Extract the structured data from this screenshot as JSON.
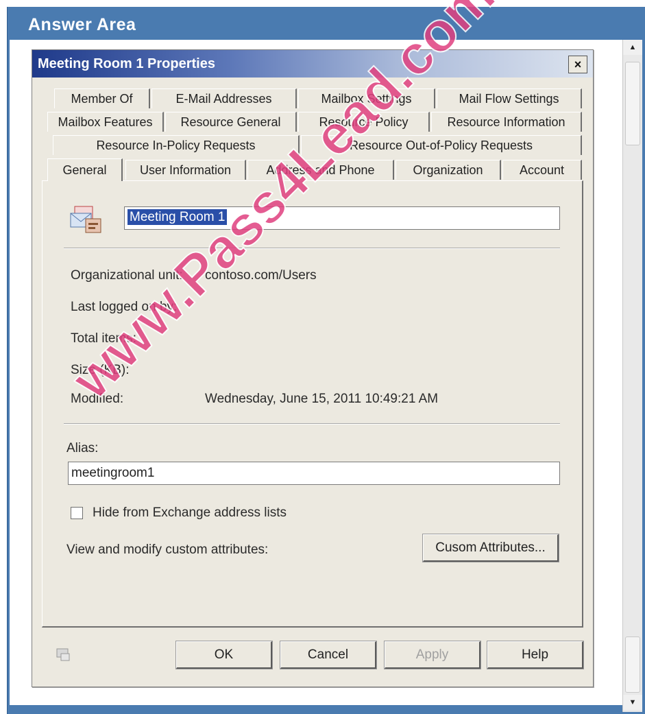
{
  "outer": {
    "title": "Answer Area"
  },
  "dialog": {
    "title": "Meeting Room 1 Properties",
    "close_glyph": "×",
    "tabs_row1": [
      "Member Of",
      "E-Mail Addresses",
      "Mailbox Settings",
      "Mail Flow Settings"
    ],
    "tabs_row2": [
      "Mailbox Features",
      "Resource General",
      "Resource Policy",
      "Resource Information"
    ],
    "tabs_row3": [
      "Resource In-Policy Requests",
      "Resource Out-of-Policy Requests"
    ],
    "tabs_row4": [
      "General",
      "User Information",
      "Address and Phone",
      "Organization",
      "Account"
    ],
    "active_tab": "General",
    "general": {
      "display_name": "Meeting Room 1",
      "ou_label": "Organizational unit:",
      "ou_value": "contoso.com/Users",
      "last_logged_label": "Last logged on by:",
      "total_items_label": "Total items:",
      "size_label": "Size (KB):",
      "modified_label": "Modified:",
      "modified_value": "Wednesday, June 15, 2011 10:49:21 AM",
      "alias_label": "Alias:",
      "alias_value": "meetingroom1",
      "hide_label": "Hide from Exchange address lists",
      "hide_checked": false,
      "custom_attr_label": "View and modify custom attributes:",
      "custom_attr_button": "Cusom Attributes..."
    },
    "buttons": {
      "ok": "OK",
      "cancel": "Cancel",
      "apply": "Apply",
      "help": "Help"
    }
  },
  "watermark": "www.Pass4Lead.com",
  "icons": {
    "mailbox": "meeting-room-mailbox-icon",
    "help": "help-icon"
  }
}
